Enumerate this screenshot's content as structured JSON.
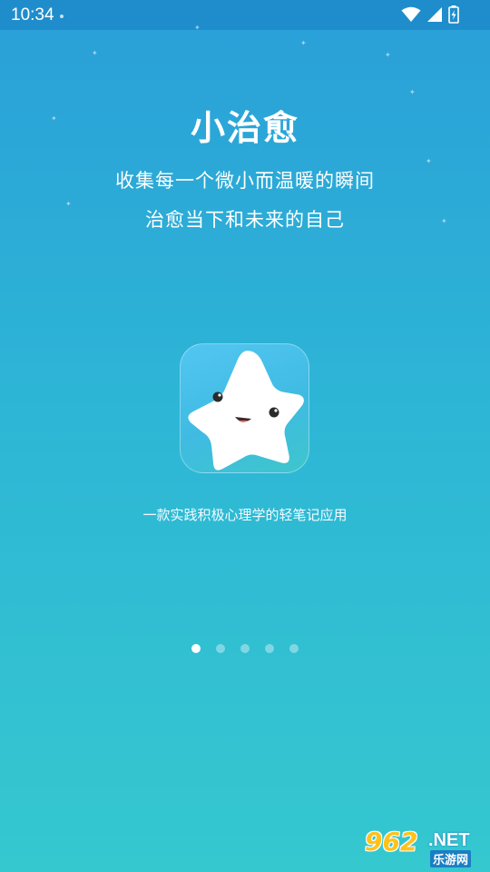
{
  "status_bar": {
    "time": "10:34",
    "icons": [
      "wifi-icon",
      "signal-icon",
      "battery-charging-icon"
    ]
  },
  "onboarding": {
    "title": "小治愈",
    "tagline_line1": "收集每一个微小而温暖的瞬间",
    "tagline_line2": "治愈当下和未来的自己",
    "app_icon": "smiling-star-icon",
    "description": "一款实践积极心理学的轻笔记应用",
    "pager": {
      "total": 5,
      "active_index": 0
    }
  },
  "watermark": {
    "number": "962",
    "domain": ".NET",
    "site_name": "乐游网"
  },
  "colors": {
    "background_top": "#2a9fd8",
    "background_bottom": "#35c8cf",
    "status_bar": "#1f8dcc",
    "text": "#ffffff"
  }
}
